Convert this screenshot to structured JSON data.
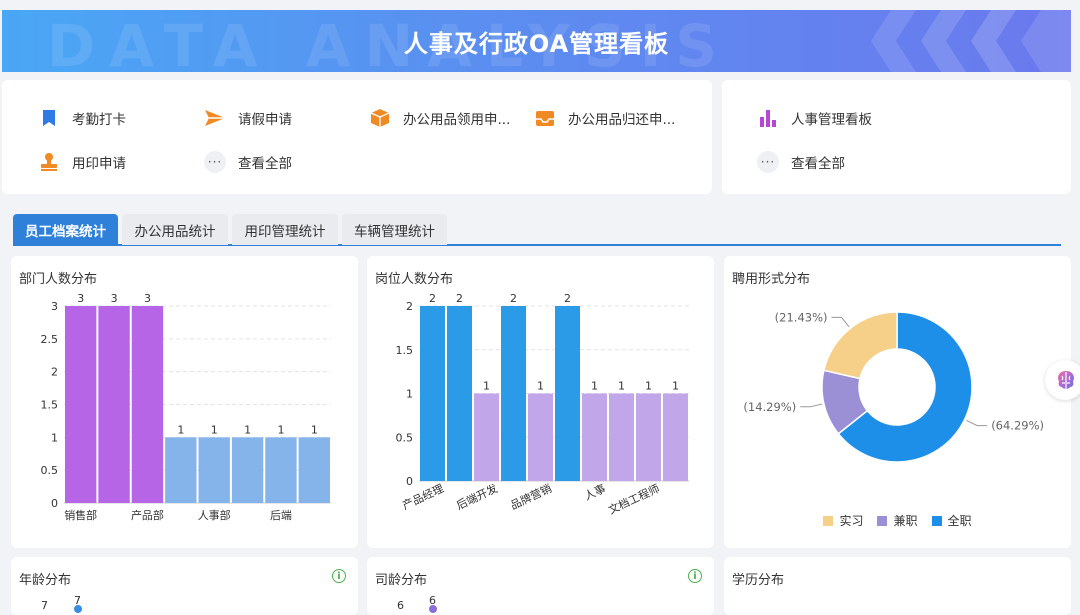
{
  "banner": {
    "title": "人事及行政OA管理看板",
    "watermark": "DATA ANALYSIS"
  },
  "quick_left": [
    {
      "label": "考勤打卡",
      "icon": "bookmark-icon",
      "color": "#2f7be5"
    },
    {
      "label": "请假申请",
      "icon": "send-icon",
      "color": "#f08a24"
    },
    {
      "label": "办公用品领用申...",
      "icon": "box-icon",
      "color": "#f08a24"
    },
    {
      "label": "办公用品归还申...",
      "icon": "inbox-icon",
      "color": "#f08a24"
    },
    {
      "label": "用印申请",
      "icon": "stamp-icon",
      "color": "#f08a24"
    },
    {
      "label": "查看全部",
      "icon": "more-icon",
      "color": "#555555"
    }
  ],
  "quick_right": [
    {
      "label": "人事管理看板",
      "icon": "bar-chart-icon",
      "color": "#b546d6"
    },
    {
      "label": "查看全部",
      "icon": "more-icon",
      "color": "#555555"
    }
  ],
  "tabs": [
    {
      "label": "员工档案统计",
      "active": true
    },
    {
      "label": "办公用品统计",
      "active": false
    },
    {
      "label": "用印管理统计",
      "active": false
    },
    {
      "label": "车辆管理统计",
      "active": false
    }
  ],
  "panels": {
    "dept": "部门人数分布",
    "post": "岗位人数分布",
    "employ": "聘用形式分布",
    "age": "年龄分布",
    "tenure": "司龄分布",
    "edu": "学历分布",
    "info_mark": "i"
  },
  "chart_data": [
    {
      "type": "bar",
      "title": "部门人数分布",
      "categories": [
        "销售部",
        "",
        "产品部",
        "",
        "人事部",
        "",
        "后端",
        ""
      ],
      "values": [
        3,
        3,
        3,
        1,
        1,
        1,
        1,
        1
      ],
      "colors": [
        "#b565e6",
        "#b565e6",
        "#b565e6",
        "#85b4ea",
        "#85b4ea",
        "#85b4ea",
        "#85b4ea",
        "#85b4ea"
      ],
      "yticks": [
        "0",
        "0.5",
        "1",
        "1.5",
        "2",
        "2.5",
        "3"
      ],
      "ylim": [
        0,
        3
      ],
      "grid": true
    },
    {
      "type": "bar",
      "title": "岗位人数分布",
      "categories": [
        "产品经理",
        "",
        "后端开发",
        "",
        "品牌营销",
        "",
        "人事",
        "",
        "文档工程师",
        ""
      ],
      "values": [
        2,
        2,
        1,
        2,
        1,
        2,
        1,
        1,
        1,
        1
      ],
      "colors": [
        "#2b9be8",
        "#2b9be8",
        "#c1a6ea",
        "#2b9be8",
        "#c1a6ea",
        "#2b9be8",
        "#c1a6ea",
        "#c1a6ea",
        "#c1a6ea",
        "#c1a6ea"
      ],
      "yticks": [
        "0",
        "0.5",
        "1",
        "1.5",
        "2"
      ],
      "ylim": [
        0,
        2
      ],
      "grid": true
    },
    {
      "type": "pie",
      "title": "聘用形式分布",
      "slices": [
        {
          "name": "全职",
          "value": 64.29,
          "label": "(64.29%)",
          "color": "#1e8fe8"
        },
        {
          "name": "兼职",
          "value": 14.29,
          "label": "(14.29%)",
          "color": "#9b8fd6"
        },
        {
          "name": "实习",
          "value": 21.43,
          "label": "(21.43%)",
          "color": "#f6cf88"
        }
      ],
      "legend": [
        "实习",
        "兼职",
        "全职"
      ],
      "legend_position": "bottom"
    },
    {
      "type": "line",
      "title": "年龄分布",
      "ytick_top": "7",
      "point_label": "7"
    },
    {
      "type": "line",
      "title": "司龄分布",
      "ytick_top": "6",
      "point_label": "6"
    }
  ]
}
